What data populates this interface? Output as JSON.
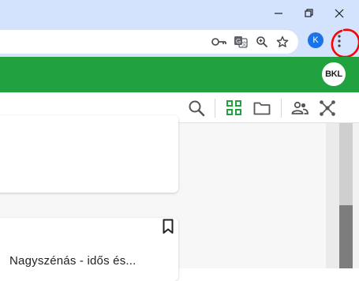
{
  "window": {
    "controls": [
      "minimize",
      "restore",
      "close"
    ]
  },
  "browser": {
    "profile_initial": "K",
    "toolbar_icons": [
      "key-icon",
      "translate-icon",
      "zoom-icon",
      "star-icon"
    ],
    "menu_icon": "more-vert-icon",
    "annotation_color": "#ff0000"
  },
  "app": {
    "brand_color": "#21a23f",
    "user_initials": "BKL",
    "actions": [
      "search-icon",
      "grid-view-icon",
      "folder-icon",
      "people-icon",
      "network-icon"
    ]
  },
  "content": {
    "card_title": "Nagyszénás - idős és..."
  }
}
